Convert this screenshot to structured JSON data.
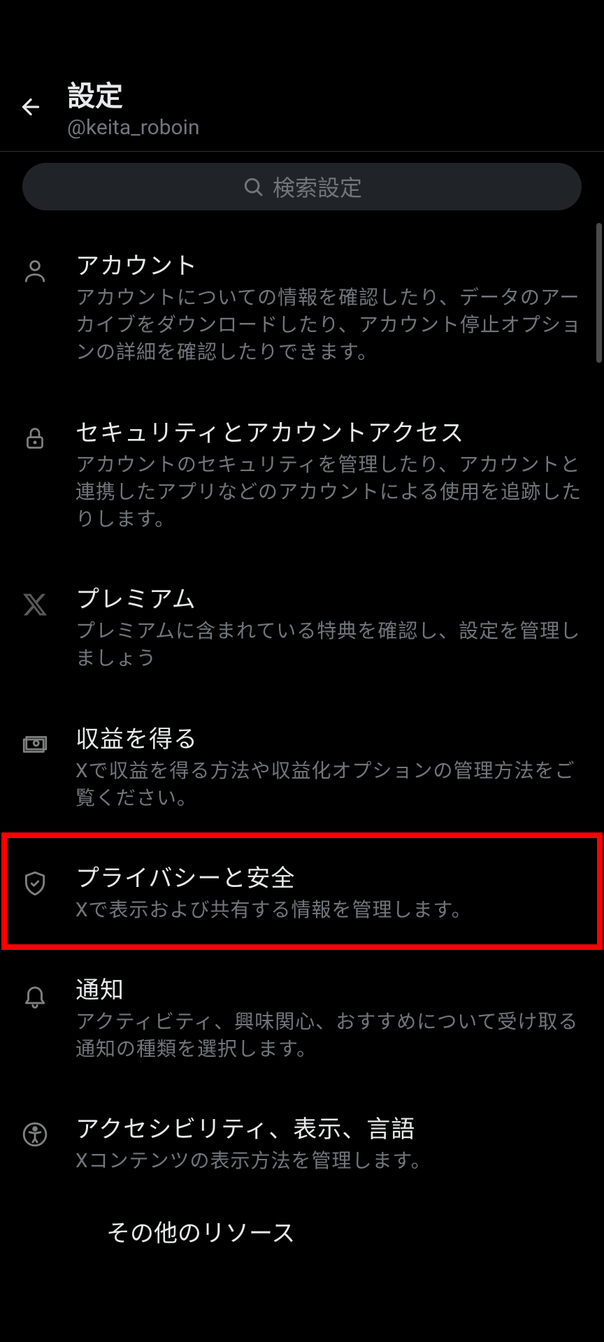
{
  "header": {
    "title": "設定",
    "username": "@keita_roboin"
  },
  "search": {
    "placeholder": "検索設定"
  },
  "items": [
    {
      "icon": "person-icon",
      "title": "アカウント",
      "desc": "アカウントについての情報を確認したり、データのアーカイブをダウンロードしたり、アカウント停止オプションの詳細を確認したりできます。"
    },
    {
      "icon": "lock-icon",
      "title": "セキュリティとアカウントアクセス",
      "desc": "アカウントのセキュリティを管理したり、アカウントと連携したアプリなどのアカウントによる使用を追跡したりします。"
    },
    {
      "icon": "x-logo-icon",
      "title": "プレミアム",
      "desc": "プレミアムに含まれている特典を確認し、設定を管理しましょう"
    },
    {
      "icon": "money-icon",
      "title": "収益を得る",
      "desc": "Xで収益を得る方法や収益化オプションの管理方法をご覧ください。"
    },
    {
      "icon": "shield-check-icon",
      "title": "プライバシーと安全",
      "desc": "Xで表示および共有する情報を管理します。"
    },
    {
      "icon": "bell-icon",
      "title": "通知",
      "desc": "アクティビティ、興味関心、おすすめについて受け取る通知の種類を選択します。"
    },
    {
      "icon": "accessibility-icon",
      "title": "アクセシビリティ、表示、言語",
      "desc": "Xコンテンツの表示方法を管理します。"
    }
  ],
  "footer_heading": "その他のリソース",
  "highlighted_index": 4
}
